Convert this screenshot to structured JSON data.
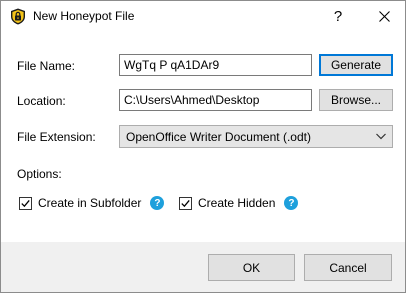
{
  "window": {
    "title": "New Honeypot File",
    "help_glyph": "?",
    "close_icon": "close-icon",
    "app_icon": "honeypot-lock-icon"
  },
  "form": {
    "file_name_label": "File Name:",
    "file_name_value": "WgTq P qA1DAr9",
    "generate_label": "Generate",
    "location_label": "Location:",
    "location_value": "C:\\Users\\Ahmed\\Desktop",
    "browse_label": "Browse...",
    "extension_label": "File Extension:",
    "extension_value": "OpenOffice Writer Document (.odt)"
  },
  "options": {
    "label": "Options:",
    "subfolder_label": "Create in Subfolder",
    "subfolder_checked": true,
    "hidden_label": "Create Hidden",
    "hidden_checked": true,
    "help_glyph": "?"
  },
  "footer": {
    "ok_label": "OK",
    "cancel_label": "Cancel"
  },
  "colors": {
    "accent": "#0078d7",
    "help_circle": "#1ea0dc",
    "footer_bg": "#f0f0f0",
    "button_bg": "#e1e1e1"
  }
}
